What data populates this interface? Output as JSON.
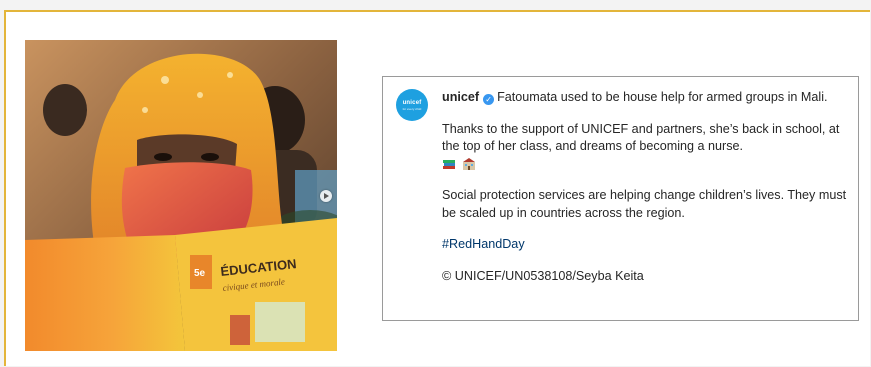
{
  "post": {
    "username": "unicef",
    "avatar_logo": "unicef",
    "avatar_sub": "for every child",
    "caption_line1": "Fatoumata used to be house help for armed groups in Mali.",
    "caption_para2": "Thanks to the support of UNICEF and partners, she’s back in school, at the top of her class, and dreams of becoming a nurse.",
    "caption_para3": "Social protection services are helping change children’s lives. They must be scaled up in countries across the region.",
    "hashtag": "#RedHandDay",
    "credit": "© UNICEF/UN0538108/Seyba Keita"
  },
  "photo": {
    "book_cover_text": "ÉDUCATION",
    "book_cover_subtext": "civique et morale",
    "book_badge": "5e"
  },
  "icons": {
    "verified": "verified-badge-icon",
    "emoji1": "books-emoji-icon",
    "emoji2": "school-emoji-icon",
    "carousel_next": "chevron-right-icon"
  },
  "colors": {
    "frame_border": "#e3b53a",
    "verified": "#3897f0",
    "hashtag": "#00376b",
    "unicef_blue": "#1ea0e0"
  }
}
